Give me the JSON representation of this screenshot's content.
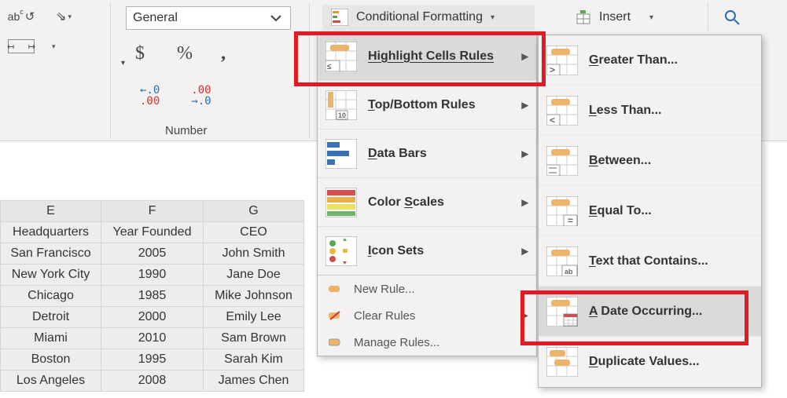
{
  "ribbon": {
    "number_format": "General",
    "currency": "$",
    "percent": "%",
    "thousands": ",",
    "dec_inc": "←.0\n.00",
    "dec_dec": ".00\n→.0",
    "group_label": "Number",
    "conditional_formatting": "Conditional Formatting",
    "insert": "Insert"
  },
  "sheet": {
    "columns": [
      "E",
      "F",
      "G"
    ],
    "headers": [
      "Headquarters",
      "Year Founded",
      "CEO"
    ],
    "rows": [
      [
        "San Francisco",
        "2005",
        "John Smith"
      ],
      [
        "New York City",
        "1990",
        "Jane Doe"
      ],
      [
        "Chicago",
        "1985",
        "Mike Johnson"
      ],
      [
        "Detroit",
        "2000",
        "Emily Lee"
      ],
      [
        "Miami",
        "2010",
        "Sam Brown"
      ],
      [
        "Boston",
        "1995",
        "Sarah Kim"
      ],
      [
        "Los Angeles",
        "2008",
        "James Chen"
      ]
    ]
  },
  "cf_menu": {
    "highlight": "Highlight Cells Rules",
    "topbottom": "Top/Bottom Rules",
    "databars": "Data Bars",
    "colorscales": "Color Scales",
    "iconsets": "Icon Sets",
    "new_rule": "New Rule...",
    "clear": "Clear Rules",
    "manage": "Manage Rules..."
  },
  "hcr_menu": {
    "greater": "Greater Than...",
    "less": "Less Than...",
    "between": "Between...",
    "equal": "Equal To...",
    "textcontains": "Text that Contains...",
    "date": "A Date Occurring...",
    "duplicate": "Duplicate Values..."
  }
}
